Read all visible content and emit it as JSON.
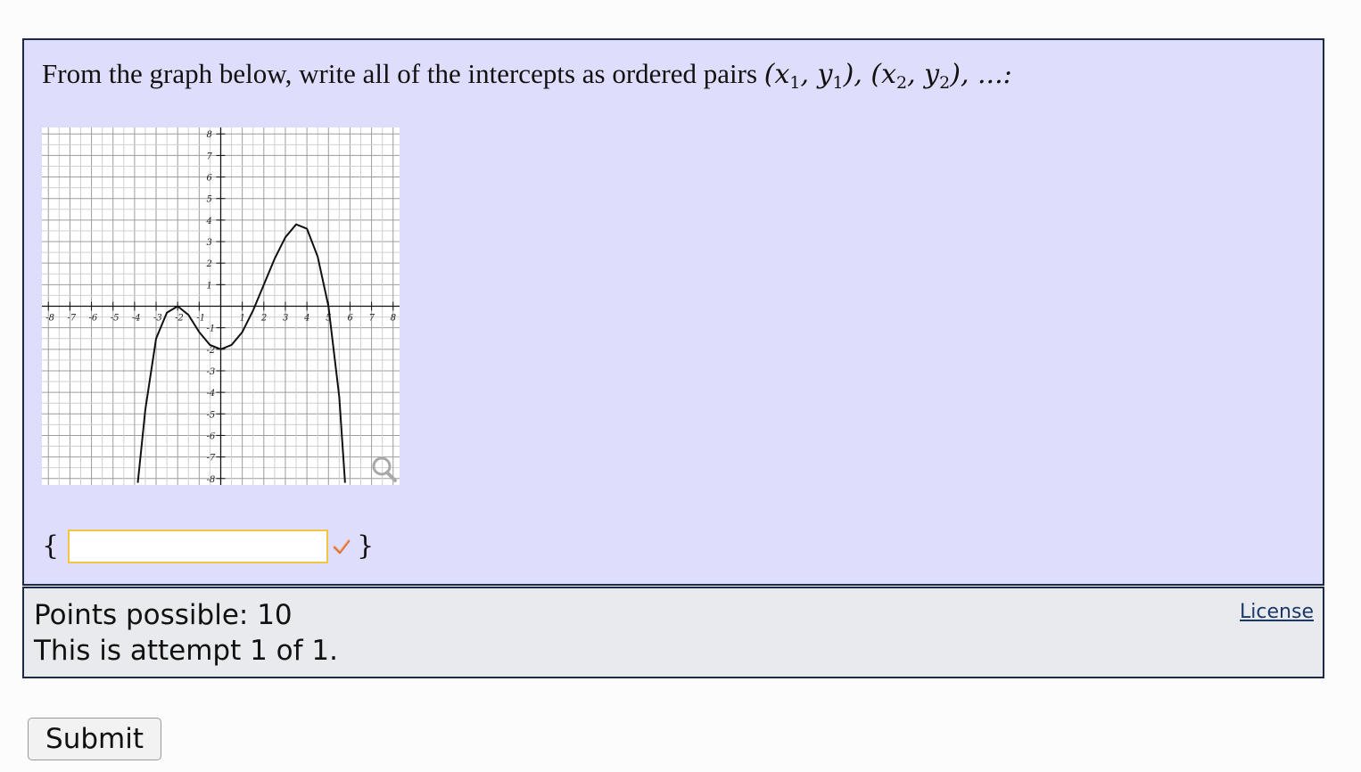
{
  "question": {
    "prompt": "From the graph below, write all of the intercepts as ordered pairs",
    "math_first": "(x",
    "sub1": "1",
    "math_comma1": ", y",
    "sub2": "1",
    "math_sep": "), (x",
    "sub3": "2",
    "math_comma2": ", y",
    "sub4": "2",
    "math_end": "), ...:",
    "open_brace": "{",
    "close_brace": "}",
    "answer_value": "",
    "answer_placeholder": ""
  },
  "graph": {
    "x_ticks": [
      "-8",
      "-7",
      "-6",
      "-5",
      "-4",
      "-3",
      "-2",
      "-1",
      "1",
      "2",
      "3",
      "4",
      "5",
      "6",
      "7",
      "8"
    ],
    "y_ticks": [
      "8",
      "7",
      "6",
      "5",
      "4",
      "3",
      "2",
      "1",
      "-1",
      "-2",
      "-3",
      "-4",
      "-5",
      "-6",
      "-7",
      "-8"
    ],
    "zoom_icon": "magnifier-icon"
  },
  "chart_data": {
    "type": "line",
    "xlim": [
      -8.3,
      8.3
    ],
    "ylim": [
      -8.3,
      8.3
    ],
    "grid": true,
    "series": [
      {
        "x": [
          -3.85,
          -3.5,
          -3.0,
          -2.5,
          -2.0,
          -1.5,
          -1.0,
          -0.5,
          0.0,
          0.5,
          1.0,
          1.5,
          2.0,
          2.5,
          3.0,
          3.5,
          4.0,
          4.5,
          5.0,
          5.5,
          5.77
        ],
        "y": [
          -8.2,
          -4.8,
          -1.5,
          -0.3,
          0.0,
          -0.4,
          -1.2,
          -1.8,
          -2.0,
          -1.8,
          -1.2,
          -0.2,
          1.0,
          2.2,
          3.2,
          3.8,
          3.6,
          2.3,
          0.0,
          -4.2,
          -8.2
        ]
      }
    ]
  },
  "info": {
    "points": "Points possible: 10",
    "attempt": "This is attempt 1 of 1.",
    "license": "License"
  },
  "actions": {
    "submit_label": "Submit"
  },
  "colors": {
    "question_bg": "#dedefc",
    "input_border": "#f4c542",
    "check": "#e0703a"
  }
}
